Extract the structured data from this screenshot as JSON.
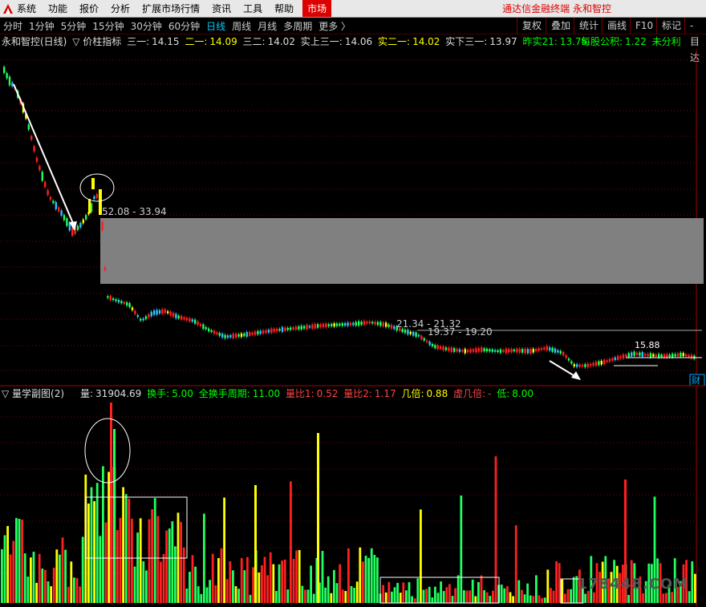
{
  "menu": {
    "items": [
      "系统",
      "功能",
      "报价",
      "分析",
      "扩展市场行情",
      "资讯",
      "工具",
      "帮助"
    ],
    "market": "市场",
    "brand": "通达信金融终端 永和智控"
  },
  "toolbar": {
    "timeframes": [
      "分时",
      "1分钟",
      "5分钟",
      "15分钟",
      "30分钟",
      "60分钟",
      "日线",
      "周线",
      "月线",
      "多周期",
      "更多 〉"
    ],
    "active": "日线",
    "right_buttons": [
      "复权",
      "叠加",
      "统计",
      "画线",
      "F10",
      "标记",
      "-目达"
    ]
  },
  "main_info": {
    "title": "永和智控(日线)",
    "indicator": "▽ 价柱指标",
    "fields": [
      {
        "label": "三一:",
        "value": "14.15",
        "color": "w"
      },
      {
        "label": "二一:",
        "value": "14.09",
        "color": "y"
      },
      {
        "label": "三二:",
        "value": "14.02",
        "color": "w"
      },
      {
        "label": "实上三一:",
        "value": "14.06",
        "color": "w"
      },
      {
        "label": "实二一:",
        "value": "14.02",
        "color": "y"
      },
      {
        "label": "实下三一:",
        "value": "13.97",
        "color": "w"
      },
      {
        "label": "昨实21:",
        "value": "13.75",
        "color": "g"
      }
    ],
    "right_fields": [
      {
        "label": "每股公积:",
        "value": "1.22",
        "color": "g"
      },
      {
        "label": "未分利",
        "value": "",
        "color": "g"
      }
    ]
  },
  "annotations": {
    "zone1": "52.08 - 33.94",
    "zone2": "21.34 - 21.32",
    "zone3": "19.37 - 19.20",
    "level": "15.88",
    "cai": "财"
  },
  "sub_info": {
    "title": "▽ 量学副图(2)",
    "fields": [
      {
        "label": "量:",
        "value": "31904.69",
        "color": "w"
      },
      {
        "label": "换手:",
        "value": "5.00",
        "color": "g"
      },
      {
        "label": "全换手周期:",
        "value": "11.00",
        "color": "g"
      },
      {
        "label": "量比1:",
        "value": "0.52",
        "color": "r"
      },
      {
        "label": "量比2:",
        "value": "1.17",
        "color": "r"
      },
      {
        "label": "几倍:",
        "value": "0.88",
        "color": "y"
      },
      {
        "label": "虚几倍:",
        "value": "-",
        "color": "r"
      },
      {
        "label": "低:",
        "value": "8.00",
        "color": "g"
      }
    ]
  },
  "watermark": "178448.COM",
  "colors": {
    "up": "#ff2020",
    "down": "#20ff60",
    "yellow": "#ffff00",
    "grid": "#800000",
    "bg": "#000000"
  }
}
